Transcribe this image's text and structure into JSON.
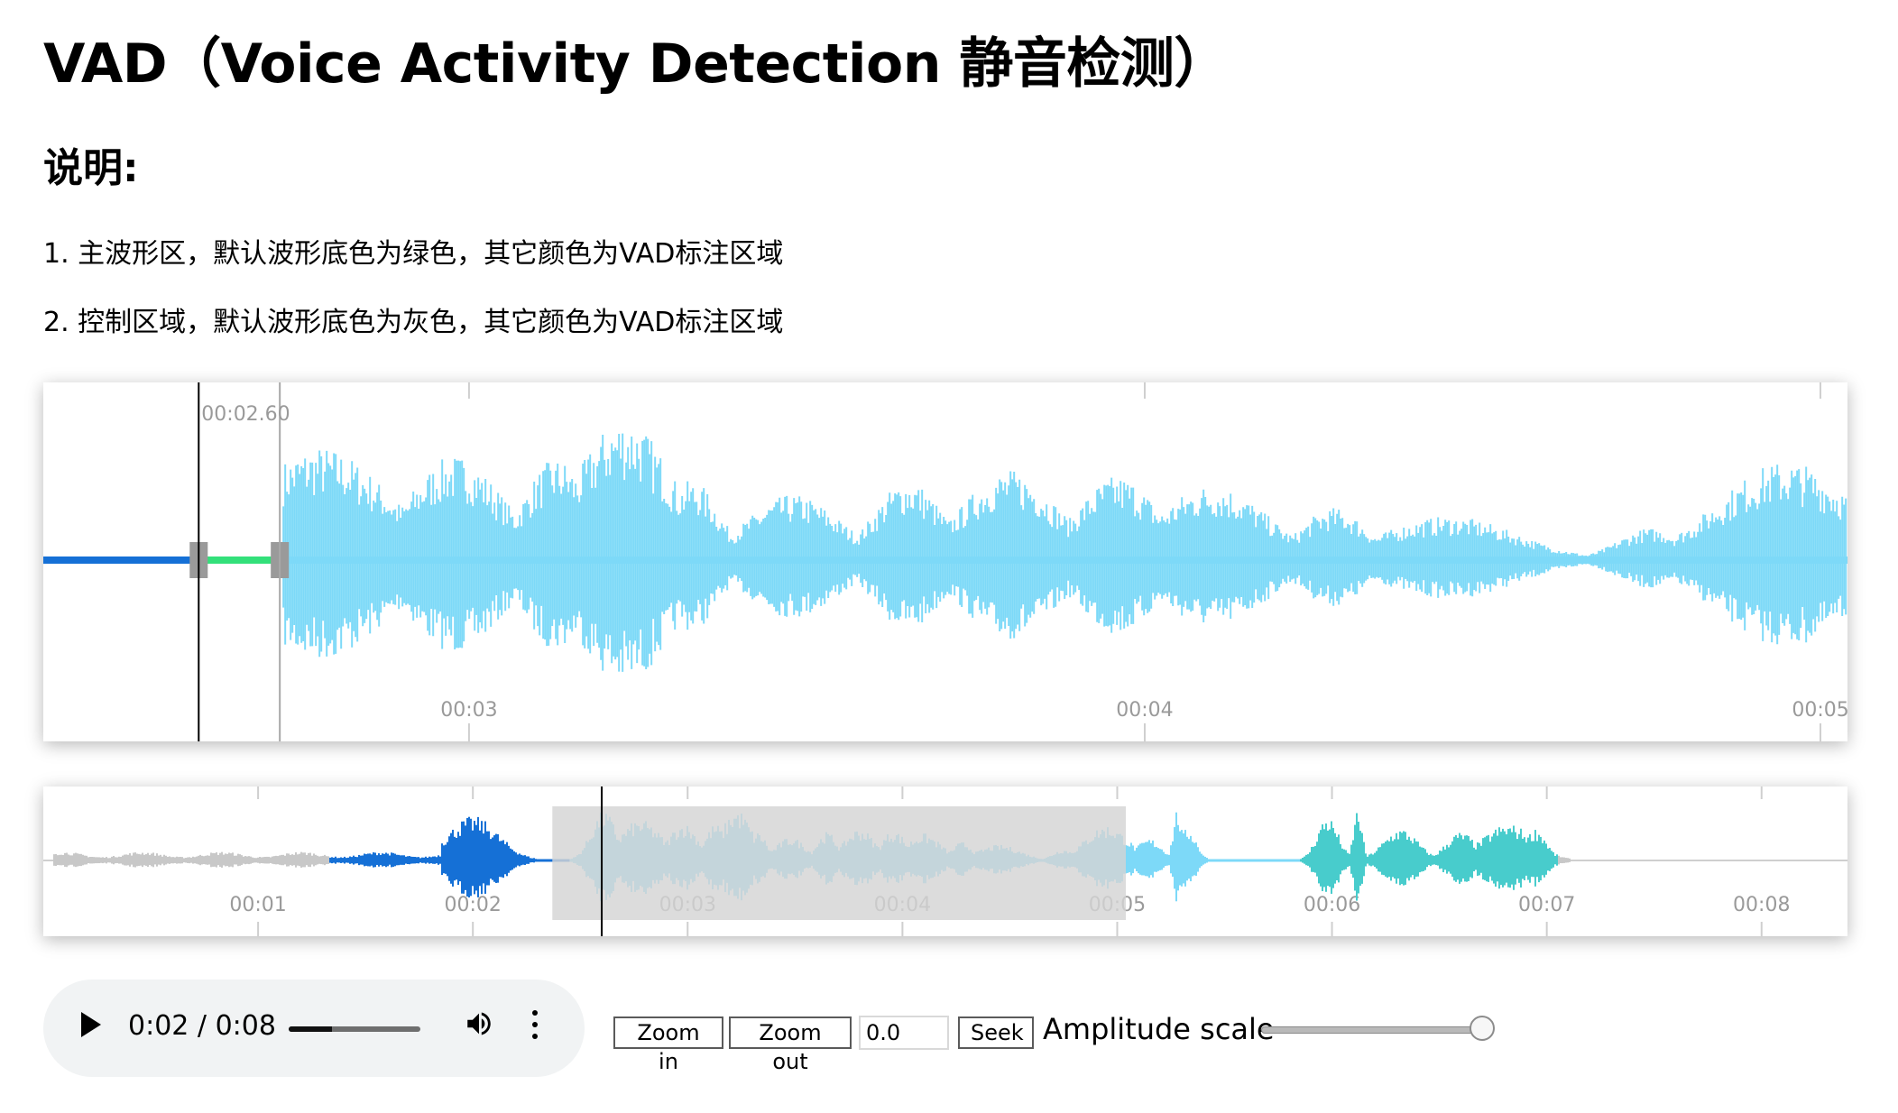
{
  "page": {
    "title": "VAD（Voice Activity Detection 静音检测）",
    "subtitle": "说明:",
    "notes": [
      "1. 主波形区，默认波形底色为绿色，其它颜色为VAD标注区域",
      "2. 控制区域，默认波形底色为灰色，其它颜色为VAD标注区域"
    ]
  },
  "colors": {
    "vad_blue": "#1570d6",
    "vad_green": "#33e07a",
    "main_wave": "#7dd9f8",
    "minimap_gray": "#c8c8c8",
    "minimap_teal": "#48cccc",
    "handle_gray": "#9a9a9a",
    "viewport_overlay": "#d4d4d4"
  },
  "main_waveform": {
    "view_start_s": 2.37,
    "view_end_s": 5.04,
    "ticks": [
      "00:03",
      "00:04",
      "00:05"
    ],
    "cursor_label": "00:02.60",
    "cursor_time_s": 2.6,
    "region_handles_s": [
      2.6,
      2.72
    ]
  },
  "minimap": {
    "duration_s": 8.4,
    "ticks": [
      "00:01",
      "00:02",
      "00:03",
      "00:04",
      "00:05",
      "00:06",
      "00:07",
      "00:08"
    ],
    "viewport_s": [
      2.37,
      5.04
    ],
    "cursor_time_s": 2.6
  },
  "player": {
    "play_icon": "play-icon",
    "current": "0:02",
    "separator": "/",
    "duration": "0:08",
    "progress": 0.33,
    "volume_icon": "speaker-icon",
    "menu_icon": "more-vertical-icon"
  },
  "controls": {
    "zoom_in": "Zoom in",
    "zoom_out": "Zoom out",
    "seek_value": "0.0",
    "seek": "Seek",
    "amplitude_label": "Amplitude scale",
    "amplitude_value": 0.95
  }
}
